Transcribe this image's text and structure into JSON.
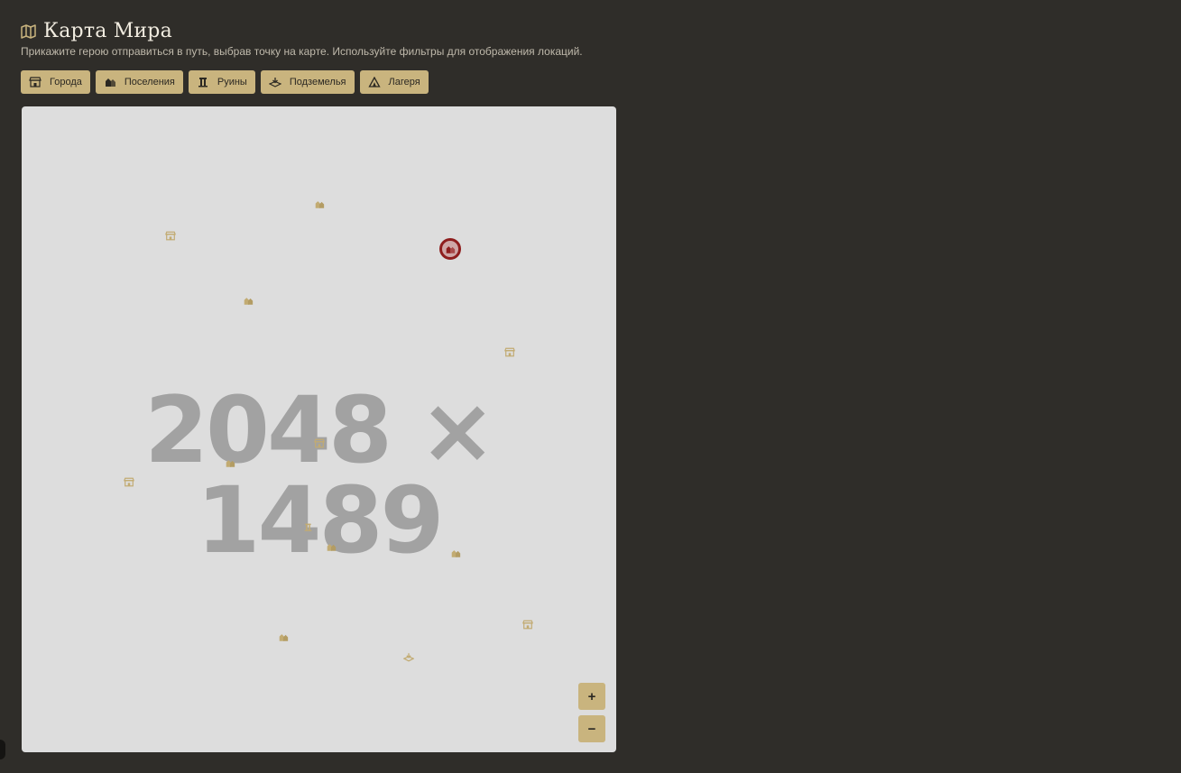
{
  "header": {
    "title": "Карта Мира",
    "subtitle": "Прикажите герою отправиться в путь, выбрав точку на карте. Используйте фильтры для отображения локаций."
  },
  "filters": [
    {
      "label": "Города",
      "icon": "city-icon"
    },
    {
      "label": "Поселения",
      "icon": "settlement-icon"
    },
    {
      "label": "Руины",
      "icon": "ruins-icon"
    },
    {
      "label": "Подземелья",
      "icon": "dungeon-icon"
    },
    {
      "label": "Лагеря",
      "icon": "camp-icon"
    }
  ],
  "map": {
    "placeholder": "2048 × 1489",
    "zoom_in": "+",
    "zoom_out": "−",
    "selected_marker": "settlement-icon"
  },
  "colors": {
    "background": "#2f2d29",
    "button": "#c9b47e",
    "map": "#dddddd",
    "marker": "#c2ab72",
    "selected": "#8e1d1d"
  }
}
